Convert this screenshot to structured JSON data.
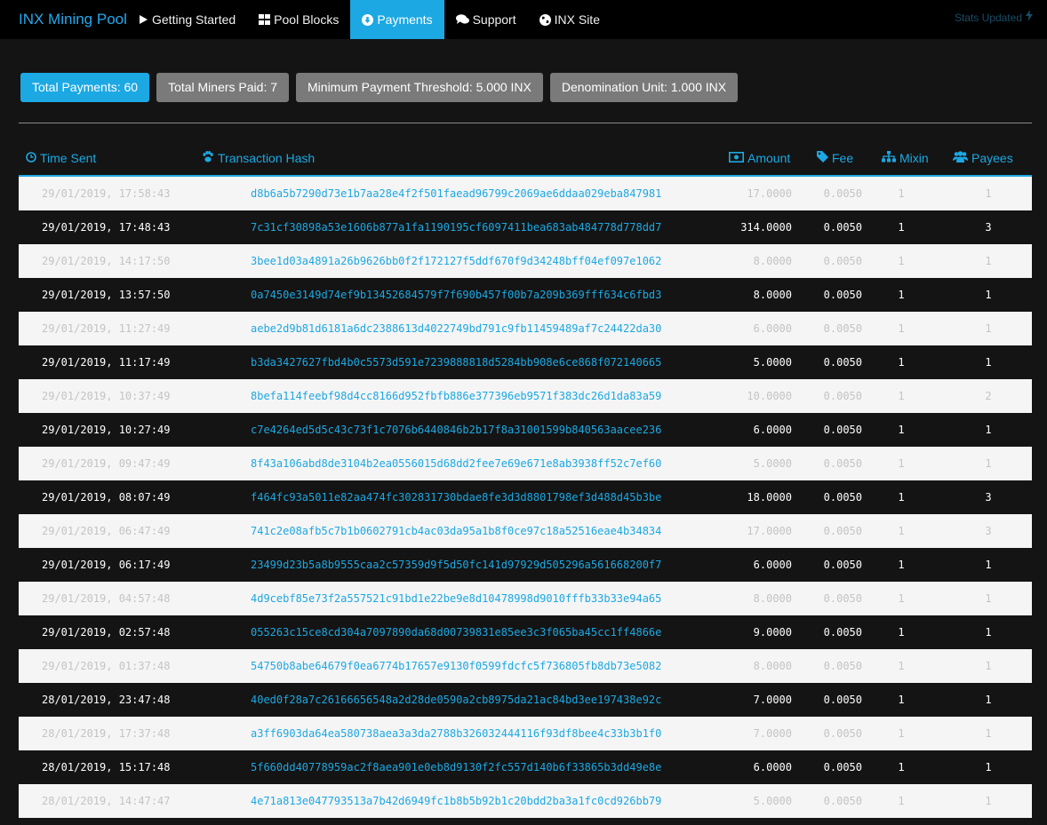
{
  "navbar": {
    "brand": "INX Mining Pool",
    "items": [
      {
        "label": "Getting Started",
        "icon": "play-icon"
      },
      {
        "label": "Pool Blocks",
        "icon": "th-large-icon"
      },
      {
        "label": "Payments",
        "icon": "circle-arrow-down-icon",
        "active": true
      },
      {
        "label": "Support",
        "icon": "comments-icon"
      },
      {
        "label": "INX Site",
        "icon": "globe-icon"
      }
    ],
    "stats_label": "Stats Updated",
    "stats_icon": "bolt-icon"
  },
  "badges": {
    "total_payments": "Total Payments: 60",
    "total_miners": "Total Miners Paid: 7",
    "min_threshold": "Minimum Payment Threshold: 5.000 INX",
    "denomination": "Denomination Unit: 1.000 INX"
  },
  "table": {
    "headers": {
      "time": "Time Sent",
      "hash": "Transaction Hash",
      "amount": "Amount",
      "fee": "Fee",
      "mixin": "Mixin",
      "payees": "Payees"
    },
    "rows": [
      {
        "time": "29/01/2019, 17:58:43",
        "hash": "d8b6a5b7290d73e1b7aa28e4f2f501faead96799c2069ae6ddaa029eba847981",
        "amount": "17.0000",
        "fee": "0.0050",
        "mixin": "1",
        "payees": "1"
      },
      {
        "time": "29/01/2019, 17:48:43",
        "hash": "7c31cf30898a53e1606b877a1fa1190195cf6097411bea683ab484778d778dd7",
        "amount": "314.0000",
        "fee": "0.0050",
        "mixin": "1",
        "payees": "3"
      },
      {
        "time": "29/01/2019, 14:17:50",
        "hash": "3bee1d03a4891a26b9626bb0f2f172127f5ddf670f9d34248bff04ef097e1062",
        "amount": "8.0000",
        "fee": "0.0050",
        "mixin": "1",
        "payees": "1"
      },
      {
        "time": "29/01/2019, 13:57:50",
        "hash": "0a7450e3149d74ef9b13452684579f7f690b457f00b7a209b369fff634c6fbd3",
        "amount": "8.0000",
        "fee": "0.0050",
        "mixin": "1",
        "payees": "1"
      },
      {
        "time": "29/01/2019, 11:27:49",
        "hash": "aebe2d9b81d6181a6dc2388613d4022749bd791c9fb11459489af7c24422da30",
        "amount": "6.0000",
        "fee": "0.0050",
        "mixin": "1",
        "payees": "1"
      },
      {
        "time": "29/01/2019, 11:17:49",
        "hash": "b3da3427627fbd4b0c5573d591e7239888818d5284bb908e6ce868f072140665",
        "amount": "5.0000",
        "fee": "0.0050",
        "mixin": "1",
        "payees": "1"
      },
      {
        "time": "29/01/2019, 10:37:49",
        "hash": "8befa114feebf98d4cc8166d952fbfb886e377396eb9571f383dc26d1da83a59",
        "amount": "10.0000",
        "fee": "0.0050",
        "mixin": "1",
        "payees": "2"
      },
      {
        "time": "29/01/2019, 10:27:49",
        "hash": "c7e4264ed5d5c43c73f1c7076b6440846b2b17f8a31001599b840563aacee236",
        "amount": "6.0000",
        "fee": "0.0050",
        "mixin": "1",
        "payees": "1"
      },
      {
        "time": "29/01/2019, 09:47:49",
        "hash": "8f43a106abd8de3104b2ea0556015d68dd2fee7e69e671e8ab3938ff52c7ef60",
        "amount": "5.0000",
        "fee": "0.0050",
        "mixin": "1",
        "payees": "1"
      },
      {
        "time": "29/01/2019, 08:07:49",
        "hash": "f464fc93a5011e82aa474fc302831730bdae8fe3d3d8801798ef3d488d45b3be",
        "amount": "18.0000",
        "fee": "0.0050",
        "mixin": "1",
        "payees": "3"
      },
      {
        "time": "29/01/2019, 06:47:49",
        "hash": "741c2e08afb5c7b1b0602791cb4ac03da95a1b8f0ce97c18a52516eae4b34834",
        "amount": "17.0000",
        "fee": "0.0050",
        "mixin": "1",
        "payees": "3"
      },
      {
        "time": "29/01/2019, 06:17:49",
        "hash": "23499d23b5a8b9555caa2c57359d9f5d50fc141d97929d505296a561668200f7",
        "amount": "6.0000",
        "fee": "0.0050",
        "mixin": "1",
        "payees": "1"
      },
      {
        "time": "29/01/2019, 04:57:48",
        "hash": "4d9cebf85e73f2a557521c91bd1e22be9e8d10478998d9010fffb33b33e94a65",
        "amount": "8.0000",
        "fee": "0.0050",
        "mixin": "1",
        "payees": "1"
      },
      {
        "time": "29/01/2019, 02:57:48",
        "hash": "055263c15ce8cd304a7097890da68d00739831e85ee3c3f065ba45cc1ff4866e",
        "amount": "9.0000",
        "fee": "0.0050",
        "mixin": "1",
        "payees": "1"
      },
      {
        "time": "29/01/2019, 01:37:48",
        "hash": "54750b8abe64679f0ea6774b17657e9130f0599fdcfc5f736805fb8db73e5082",
        "amount": "8.0000",
        "fee": "0.0050",
        "mixin": "1",
        "payees": "1"
      },
      {
        "time": "28/01/2019, 23:47:48",
        "hash": "40ed0f28a7c26166656548a2d28de0590a2cb8975da21ac84bd3ee197438e92c",
        "amount": "7.0000",
        "fee": "0.0050",
        "mixin": "1",
        "payees": "1"
      },
      {
        "time": "28/01/2019, 17:37:48",
        "hash": "a3ff6903da64ea580738aea3a3da2788b326032444116f93df8bee4c33b3b1f0",
        "amount": "7.0000",
        "fee": "0.0050",
        "mixin": "1",
        "payees": "1"
      },
      {
        "time": "28/01/2019, 15:17:48",
        "hash": "5f660dd40778959ac2f8aea901e0eb8d9130f2fc557d140b6f33865b3dd49e8e",
        "amount": "6.0000",
        "fee": "0.0050",
        "mixin": "1",
        "payees": "1"
      },
      {
        "time": "28/01/2019, 14:47:47",
        "hash": "4e71a813e047793513a7b42d6949fc1b8b5b92b1c20bdd2ba3a1fc0cd926bb79",
        "amount": "5.0000",
        "fee": "0.0050",
        "mixin": "1",
        "payees": "1"
      }
    ]
  },
  "colors": {
    "accent": "#1ca8e3",
    "badge_gray": "#7a7a7a",
    "nav_bg": "#000000",
    "page_bg": "#141414",
    "row_light": "#f5f5f5"
  }
}
